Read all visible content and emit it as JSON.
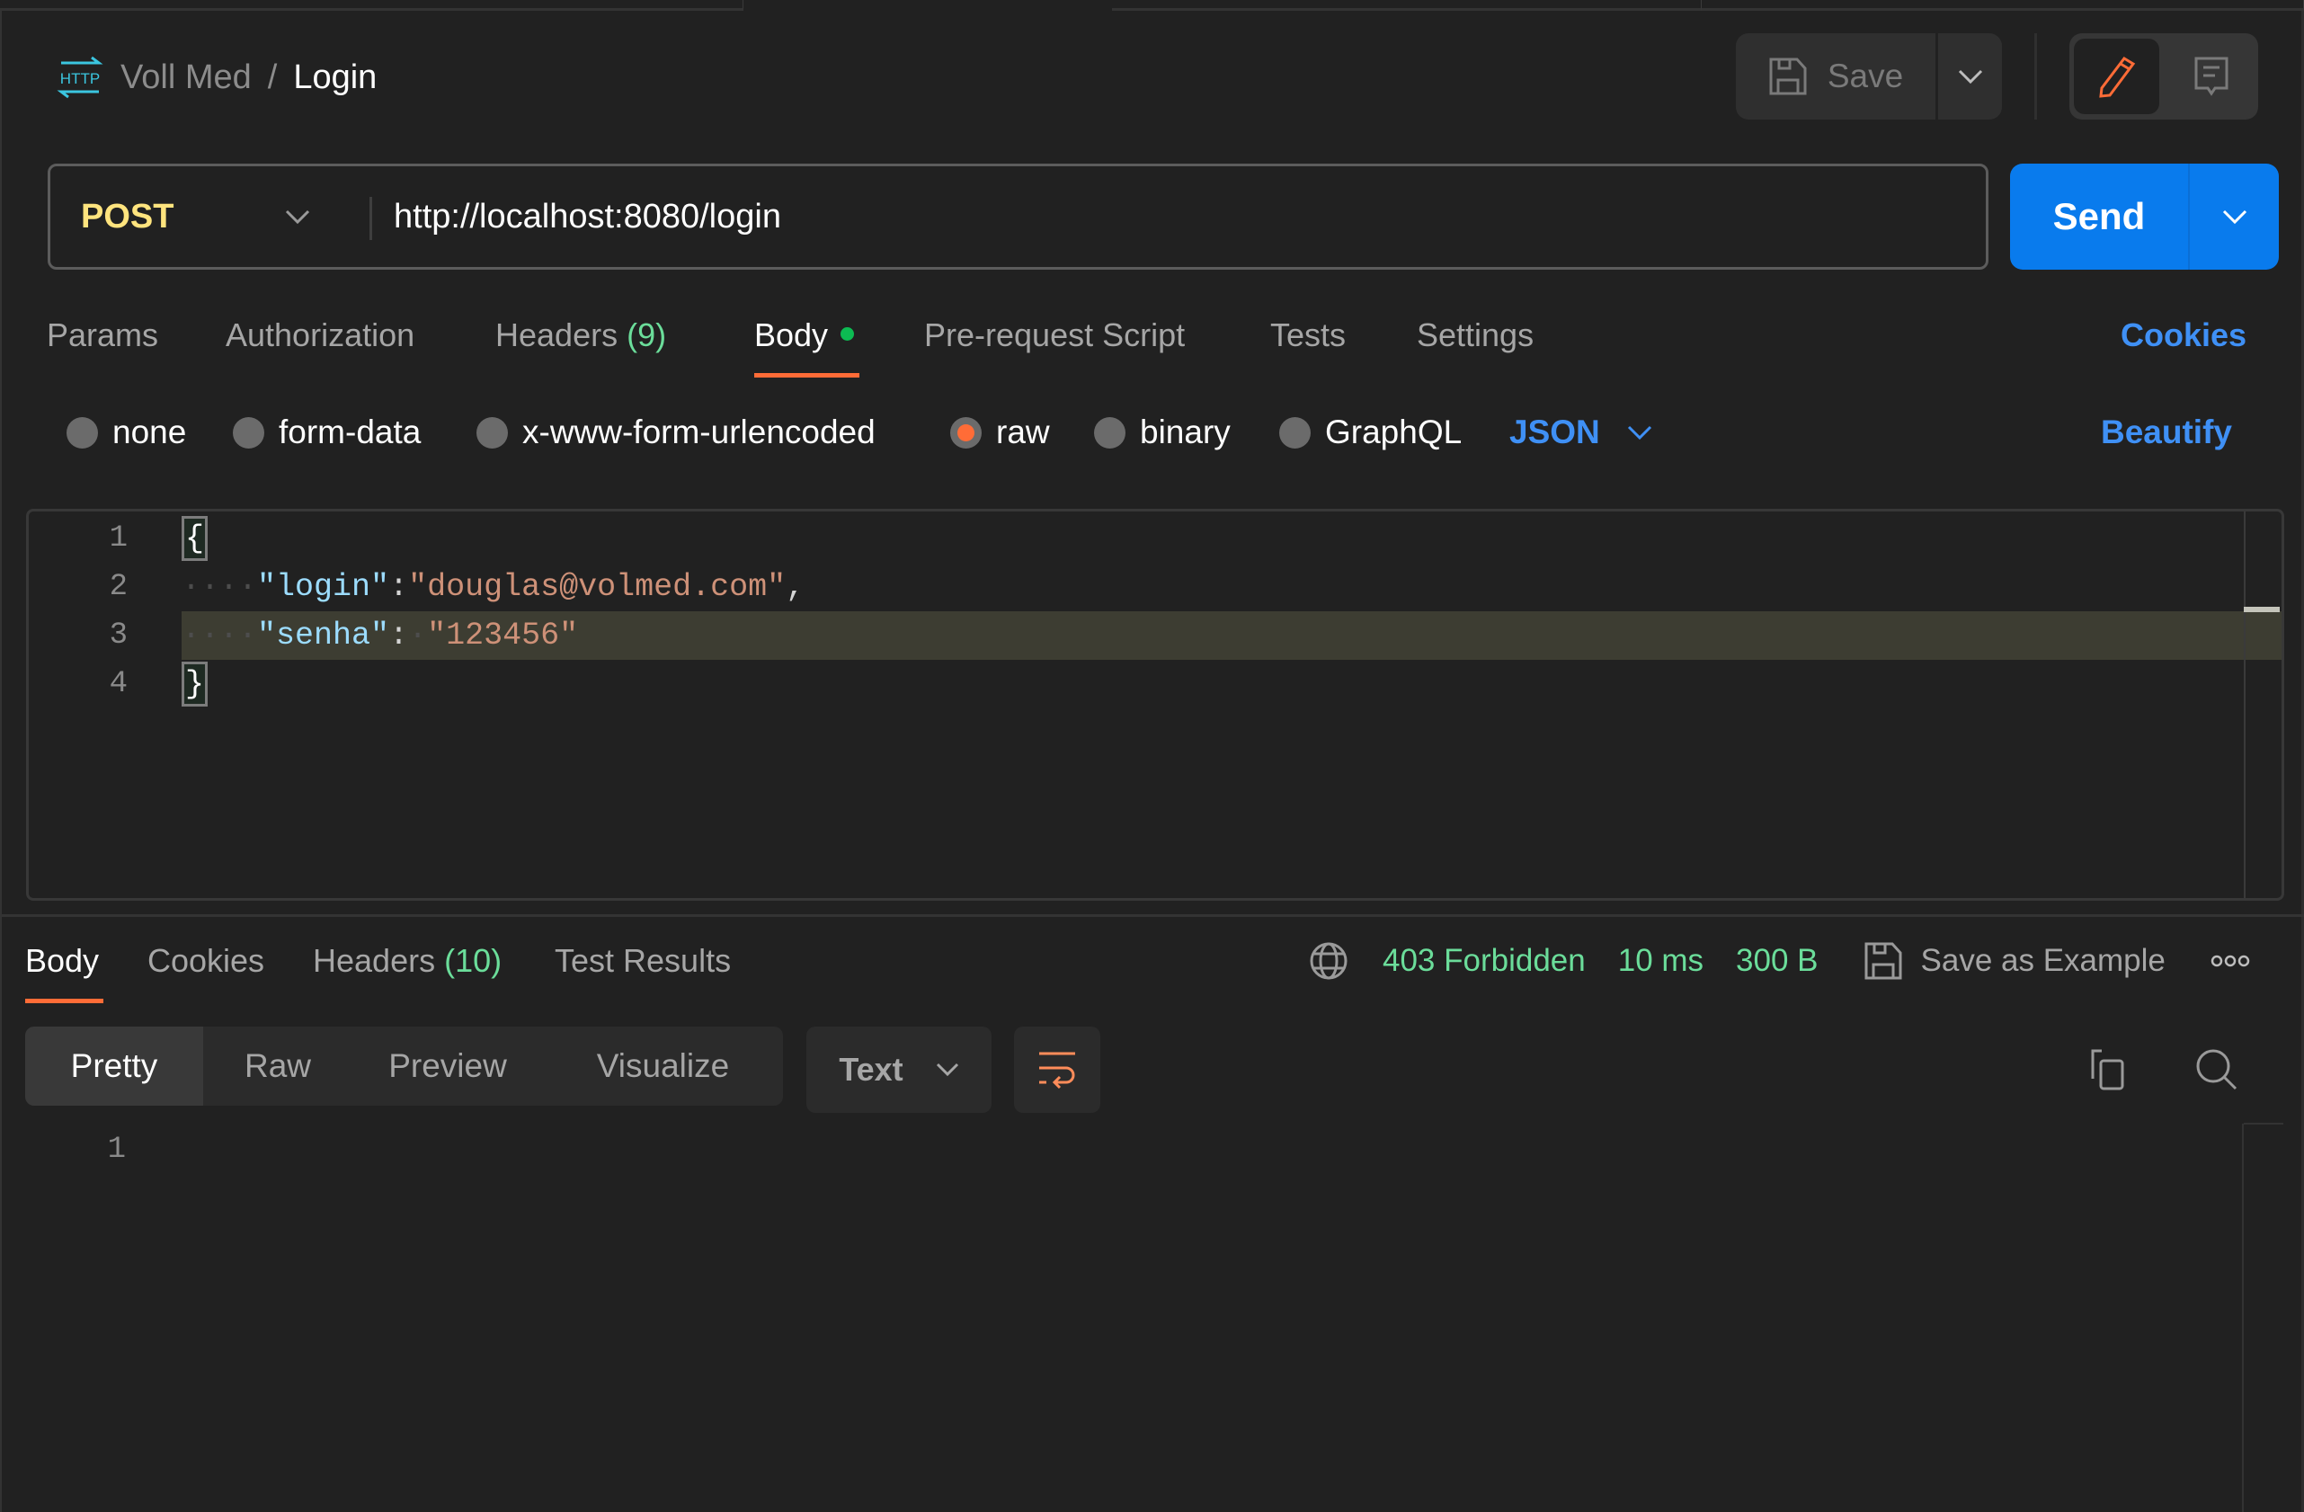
{
  "breadcrumb": {
    "icon": "http-icon",
    "collection": "Voll Med",
    "separator": "/",
    "request": "Login"
  },
  "toolbar": {
    "save_label": "Save",
    "save_icon": "floppy-disk-icon",
    "save_menu_icon": "chevron-down-icon",
    "edit_icon": "pencil-icon",
    "docs_icon": "comment-doc-icon"
  },
  "request": {
    "method": "POST",
    "url": "http://localhost:8080/login",
    "send_label": "Send"
  },
  "request_tabs": [
    {
      "label": "Params",
      "count": null,
      "active": false
    },
    {
      "label": "Authorization",
      "count": null,
      "active": false
    },
    {
      "label": "Headers",
      "count": "(9)",
      "active": false
    },
    {
      "label": "Body",
      "count": null,
      "active": true,
      "indicator": "modified-dot"
    },
    {
      "label": "Pre-request Script",
      "count": null,
      "active": false
    },
    {
      "label": "Tests",
      "count": null,
      "active": false
    },
    {
      "label": "Settings",
      "count": null,
      "active": false
    }
  ],
  "cookies_label": "Cookies",
  "body_types": [
    {
      "label": "none",
      "selected": false
    },
    {
      "label": "form-data",
      "selected": false
    },
    {
      "label": "x-www-form-urlencoded",
      "selected": false
    },
    {
      "label": "raw",
      "selected": true
    },
    {
      "label": "binary",
      "selected": false
    },
    {
      "label": "GraphQL",
      "selected": false
    }
  ],
  "raw_format": "JSON",
  "beautify_label": "Beautify",
  "editor": {
    "line_numbers": [
      "1",
      "2",
      "3",
      "4"
    ],
    "highlighted_line": 3,
    "lines": {
      "l1": {
        "brace": "{"
      },
      "l2": {
        "indent": "····",
        "key": "\"login\"",
        "colon": ":",
        "value": "\"douglas@volmed.com\"",
        "trail": ","
      },
      "l3": {
        "indent": "····",
        "key": "\"senha\"",
        "colon": ":",
        "space": "·",
        "value": "\"123456\""
      },
      "l4": {
        "brace": "}"
      }
    }
  },
  "response": {
    "tabs": [
      {
        "label": "Body",
        "count": null,
        "active": true
      },
      {
        "label": "Cookies",
        "count": null,
        "active": false
      },
      {
        "label": "Headers",
        "count": "(10)",
        "active": false
      },
      {
        "label": "Test Results",
        "count": null,
        "active": false
      }
    ],
    "network_icon": "globe-icon",
    "status": "403 Forbidden",
    "time": "10 ms",
    "size": "300 B",
    "save_example_label": "Save as Example",
    "more_icon": "more-horizontal-icon",
    "view_modes": [
      "Pretty",
      "Raw",
      "Preview",
      "Visualize"
    ],
    "active_view": "Pretty",
    "format": "Text",
    "wrap_icon": "wrap-lines-icon",
    "copy_icon": "copy-icon",
    "search_icon": "search-icon",
    "line_numbers": [
      "1"
    ]
  },
  "colors": {
    "accent": "#ff6c37",
    "primary_button": "#097bed",
    "link": "#3f90f5",
    "method_post": "#ffe47e",
    "success_text": "#6bdd9a",
    "modified_dot": "#0cbb52",
    "background": "#212121"
  }
}
